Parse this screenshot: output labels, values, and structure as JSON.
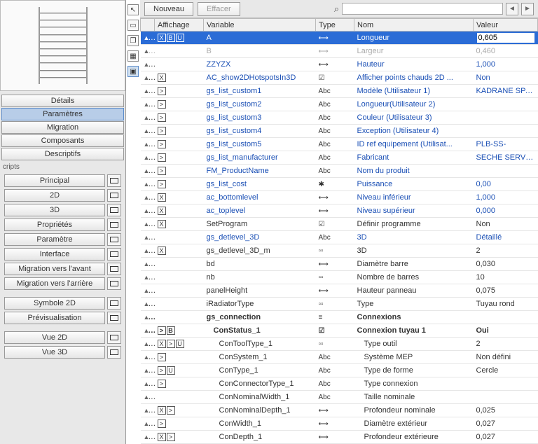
{
  "sidebar": {
    "tabs": [
      {
        "label": "Détails",
        "selected": false
      },
      {
        "label": "Paramètres",
        "selected": true
      },
      {
        "label": "Migration",
        "selected": false
      },
      {
        "label": "Composants",
        "selected": false
      },
      {
        "label": "Descriptifs",
        "selected": false
      }
    ],
    "scripts_label": "cripts",
    "scripts": [
      {
        "label": "Principal"
      },
      {
        "label": "2D"
      },
      {
        "label": "3D"
      },
      {
        "label": "Propriétés"
      },
      {
        "label": "Paramètre"
      },
      {
        "label": "Interface"
      },
      {
        "label": "Migration vers l'avant"
      },
      {
        "label": "Migration vers l'arrière"
      }
    ],
    "extras": [
      {
        "label": "Symbole 2D"
      },
      {
        "label": "Prévisualisation"
      }
    ],
    "views": [
      {
        "label": "Vue 2D"
      },
      {
        "label": "Vue 3D"
      }
    ]
  },
  "toolbar": {
    "new_label": "Nouveau",
    "clear_label": "Effacer",
    "search_placeholder": ""
  },
  "headers": {
    "affichage": "Affichage",
    "variable": "Variable",
    "type": "Type",
    "nom": "Nom",
    "valeur": "Valeur"
  },
  "rows": [
    {
      "sel": true,
      "aff": "XBU",
      "var": "A",
      "type": "len",
      "nom": "Longueur",
      "val": "0,605",
      "cls": ""
    },
    {
      "aff": "",
      "var": "B",
      "type": "len",
      "nom": "Largeur",
      "val": "0,460",
      "cls": "greyed"
    },
    {
      "aff": "",
      "var": "ZZYZX",
      "type": "len",
      "nom": "Hauteur",
      "val": "1,000",
      "cls": "blue"
    },
    {
      "aff": "X",
      "var": "AC_show2DHotspotsIn3D",
      "type": "bool",
      "nom": "Afficher points chauds 2D ...",
      "val": "Non",
      "cls": "blue"
    },
    {
      "aff": ">",
      "var": "gs_list_custom1",
      "type": "Abc",
      "nom": "Modèle (Utilisateur 1)",
      "val": "KADRANE SPA - KAR",
      "cls": "blue"
    },
    {
      "aff": ">",
      "var": "gs_list_custom2",
      "type": "Abc",
      "nom": "Longueur(Utilisateur 2)",
      "val": "",
      "cls": "blue"
    },
    {
      "aff": ">",
      "var": "gs_list_custom3",
      "type": "Abc",
      "nom": "Couleur (Utilisateur 3)",
      "val": "",
      "cls": "blue"
    },
    {
      "aff": ">",
      "var": "gs_list_custom4",
      "type": "Abc",
      "nom": "Exception (Utilisateur 4)",
      "val": "",
      "cls": "blue"
    },
    {
      "aff": ">",
      "var": "gs_list_custom5",
      "type": "Abc",
      "nom": "ID ref equipement (Utilisat...",
      "val": "PLB-SS-",
      "cls": "blue"
    },
    {
      "aff": ">",
      "var": "gs_list_manufacturer",
      "type": "Abc",
      "nom": "Fabricant",
      "val": "SECHE SERVIETTE",
      "cls": "blue"
    },
    {
      "aff": ">",
      "var": "FM_ProductName",
      "type": "Abc",
      "nom": "Nom du produit",
      "val": "",
      "cls": "blue"
    },
    {
      "aff": ">",
      "var": "gs_list_cost",
      "type": "num",
      "nom": "Puissance",
      "val": "0,00",
      "cls": "blue"
    },
    {
      "aff": "X",
      "var": "ac_bottomlevel",
      "type": "len",
      "nom": "Niveau inférieur",
      "val": "1,000",
      "cls": "blue"
    },
    {
      "aff": "X",
      "var": "ac_toplevel",
      "type": "len",
      "nom": "Niveau supérieur",
      "val": "0,000",
      "cls": "blue"
    },
    {
      "aff": "X",
      "var": "SetProgram",
      "type": "bool",
      "nom": "Définir programme",
      "val": "Non",
      "cls": ""
    },
    {
      "aff": "",
      "var": "gs_detlevel_3D",
      "type": "Abc",
      "nom": "3D",
      "val": "Détaillé",
      "cls": "blue"
    },
    {
      "aff": "X",
      "var": "gs_detlevel_3D_m",
      "type": "int",
      "nom": "3D",
      "val": "2",
      "cls": ""
    },
    {
      "aff": "",
      "var": "bd",
      "type": "len",
      "nom": "Diamètre barre",
      "val": "0,030",
      "cls": ""
    },
    {
      "aff": "",
      "var": "nb",
      "type": "int",
      "nom": "Nombre de barres",
      "val": "10",
      "cls": ""
    },
    {
      "aff": "",
      "var": "panelHeight",
      "type": "len",
      "nom": "Hauteur panneau",
      "val": "0,075",
      "cls": ""
    },
    {
      "aff": "",
      "var": "iRadiatorType",
      "type": "int",
      "nom": "Type",
      "val": "Tuyau rond",
      "cls": ""
    },
    {
      "aff": "",
      "var": "gs_connection",
      "type": "title",
      "nom": "Connexions",
      "val": "",
      "cls": "boldrow"
    },
    {
      "aff": "> B",
      "var": "ConStatus_1",
      "type": "bool",
      "nom": "Connexion tuyau 1",
      "val": "Oui",
      "cls": "boldrow",
      "indent": 1
    },
    {
      "aff": "X > U",
      "var": "ConToolType_1",
      "type": "int",
      "nom": "Type outil",
      "val": "2",
      "cls": "",
      "indent": 2
    },
    {
      "aff": ">",
      "var": "ConSystem_1",
      "type": "Abc",
      "nom": "Système MEP",
      "val": "Non défini",
      "cls": "",
      "indent": 2
    },
    {
      "aff": "> U",
      "var": "ConType_1",
      "type": "Abc",
      "nom": "Type de forme",
      "val": "Cercle",
      "cls": "",
      "indent": 2
    },
    {
      "aff": ">",
      "var": "ConConnectorType_1",
      "type": "Abc",
      "nom": "Type connexion",
      "val": "",
      "cls": "",
      "indent": 2
    },
    {
      "aff": "",
      "var": "ConNominalWidth_1",
      "type": "Abc",
      "nom": "Taille nominale",
      "val": "",
      "cls": "",
      "indent": 2
    },
    {
      "aff": "X >",
      "var": "ConNominalDepth_1",
      "type": "len",
      "nom": "Profondeur nominale",
      "val": "0,025",
      "cls": "",
      "indent": 2
    },
    {
      "aff": ">",
      "var": "ConWidth_1",
      "type": "len",
      "nom": "Diamètre extérieur",
      "val": "0,027",
      "cls": "",
      "indent": 2
    },
    {
      "aff": "X >",
      "var": "ConDepth_1",
      "type": "len",
      "nom": "Profondeur extérieure",
      "val": "0,027",
      "cls": "",
      "indent": 2
    }
  ],
  "typeIcons": {
    "len": "⟷",
    "bool": "☑",
    "Abc": "Abc",
    "num": "✱",
    "int": "▫▫",
    "title": "≡"
  }
}
